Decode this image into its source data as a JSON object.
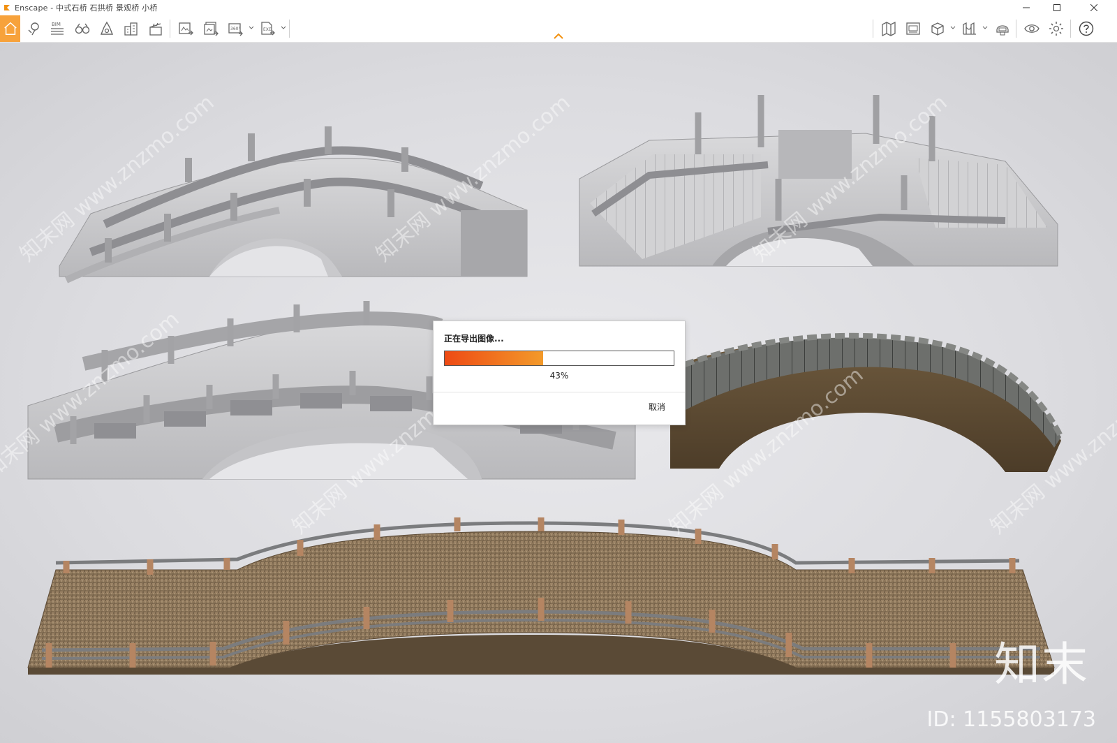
{
  "window": {
    "title": "Enscape - 中式石桥 石拱桥 景观桥 小桥",
    "accent": "#f7a23b"
  },
  "toolbar": {
    "bim_label": "BIM",
    "left_icons": [
      "home-icon",
      "location-pin-icon",
      "bim-icon",
      "binoculars-icon",
      "bell-icon",
      "buildings-icon",
      "clapperboard-icon",
      "export-image-icon",
      "export-batch-icon",
      "export-360-icon",
      "export-exe-icon"
    ],
    "right_icons": [
      "map-icon",
      "panel-icon",
      "cube-icon",
      "bridge-icon",
      "helmet-icon",
      "eye-icon",
      "gear-icon",
      "help-icon"
    ]
  },
  "viewport": {
    "watermark_text": "知末网 www.znzmo.com",
    "brand_logo": "知末",
    "brand_id": "ID: 1155803173"
  },
  "export_dialog": {
    "title": "正在导出图像...",
    "progress": 0.43,
    "progress_text": "43%",
    "cancel_label": "取消",
    "colors": {
      "fill_start": "#ee4a14",
      "fill_end": "#f39a2a"
    }
  }
}
